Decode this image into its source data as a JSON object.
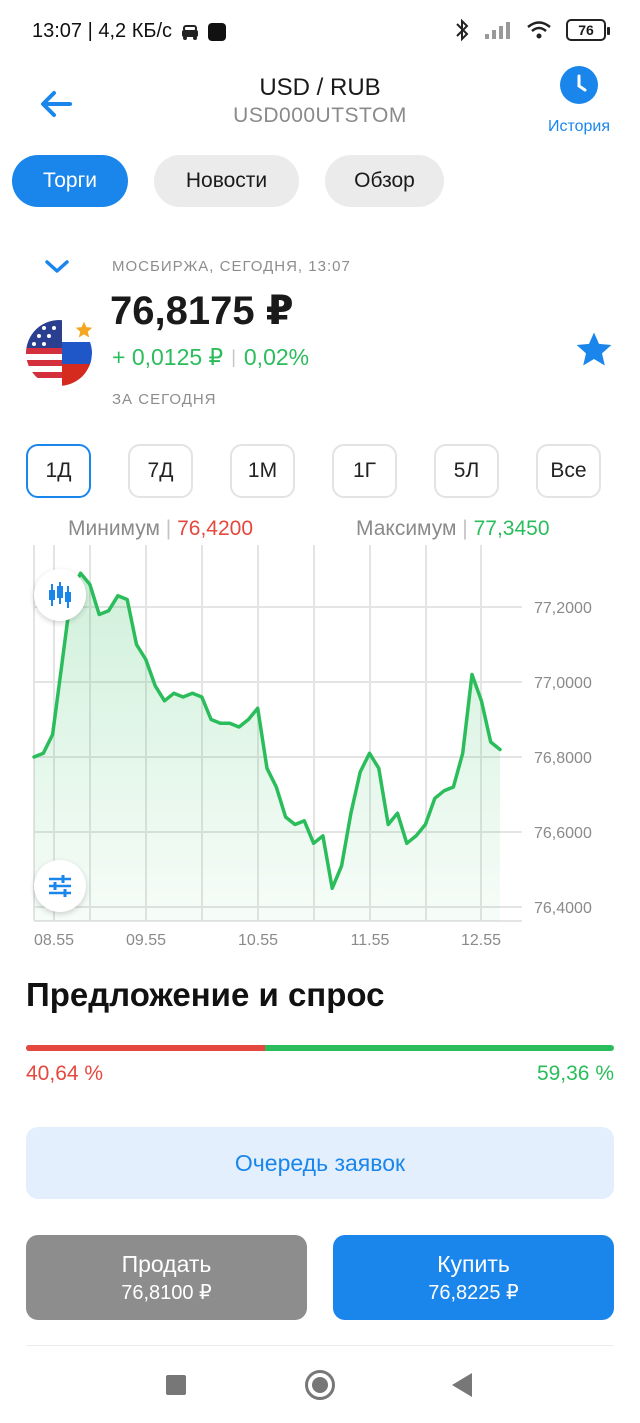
{
  "status_bar": {
    "time_speed": "13:07 | 4,2 КБ/с",
    "battery": "76"
  },
  "header": {
    "title": "USD / RUB",
    "subtitle": "USD000UTSTOM",
    "history_label": "История"
  },
  "tabs": [
    {
      "label": "Торги",
      "active": true
    },
    {
      "label": "Новости",
      "active": false
    },
    {
      "label": "Обзор",
      "active": false
    }
  ],
  "quote": {
    "exchange_line": "МОСБИРЖА, СЕГОДНЯ, 13:07",
    "price": "76,8175 ₽",
    "change_abs": "+ 0,0125 ₽",
    "change_sep": "|",
    "change_pct": "0,02%",
    "period_label": "ЗА СЕГОДНЯ"
  },
  "periods": [
    {
      "label": "1Д",
      "active": true
    },
    {
      "label": "7Д",
      "active": false
    },
    {
      "label": "1М",
      "active": false
    },
    {
      "label": "1Г",
      "active": false
    },
    {
      "label": "5Л",
      "active": false
    },
    {
      "label": "Все",
      "active": false
    }
  ],
  "range": {
    "min_label": "Минимум",
    "min_value": "76,4200",
    "max_label": "Максимум",
    "max_value": "77,3450",
    "sep": "|"
  },
  "depth": {
    "title": "Предложение и спрос",
    "bid_pct": 40.64,
    "bid_label": "40,64 %",
    "ask_label": "59,36 %"
  },
  "orders_button": "Очередь заявок",
  "sell": {
    "label": "Продать",
    "price": "76,8100 ₽"
  },
  "buy": {
    "label": "Купить",
    "price": "76,8225 ₽"
  },
  "colors": {
    "accent": "#1a86ec",
    "positive": "#2bbd5b",
    "negative": "#e5483e"
  },
  "chart_data": {
    "type": "area",
    "xlabel": "",
    "ylabel": "",
    "x_ticks": [
      "08.55",
      "09.55",
      "10.55",
      "11.55",
      "12.55"
    ],
    "y_ticks": [
      "77,2000",
      "77,0000",
      "76,8000",
      "76,6000",
      "76,4000"
    ],
    "ylim": [
      76.35,
      77.35
    ],
    "x": [
      "08.45",
      "08.50",
      "08.55",
      "09.00",
      "09.05",
      "09.10",
      "09.15",
      "09.20",
      "09.25",
      "09.30",
      "09.35",
      "09.40",
      "09.45",
      "09.50",
      "09.55",
      "10.00",
      "10.05",
      "10.10",
      "10.15",
      "10.20",
      "10.25",
      "10.30",
      "10.35",
      "10.40",
      "10.45",
      "10.50",
      "10.55",
      "11.00",
      "11.05",
      "11.10",
      "11.15",
      "11.20",
      "11.25",
      "11.30",
      "11.35",
      "11.40",
      "11.45",
      "11.50",
      "11.55",
      "12.00",
      "12.05",
      "12.10",
      "12.15",
      "12.20",
      "12.25",
      "12.30",
      "12.35",
      "12.40",
      "12.45",
      "12.50",
      "12.55",
      "13.00",
      "13.05"
    ],
    "series": [
      {
        "values": [
          76.8,
          76.81,
          76.86,
          77.05,
          77.24,
          77.29,
          77.26,
          77.18,
          77.19,
          77.23,
          77.22,
          77.1,
          77.06,
          76.99,
          76.95,
          76.97,
          76.96,
          76.97,
          76.96,
          76.9,
          76.89,
          76.89,
          76.88,
          76.9,
          76.93,
          76.77,
          76.72,
          76.64,
          76.62,
          76.63,
          76.57,
          76.59,
          76.45,
          76.51,
          76.65,
          76.76,
          76.81,
          76.77,
          76.62,
          76.65,
          76.57,
          76.59,
          76.62,
          76.69,
          76.71,
          76.72,
          76.81,
          77.02,
          76.95,
          76.84,
          76.82
        ]
      }
    ],
    "grid": true
  }
}
